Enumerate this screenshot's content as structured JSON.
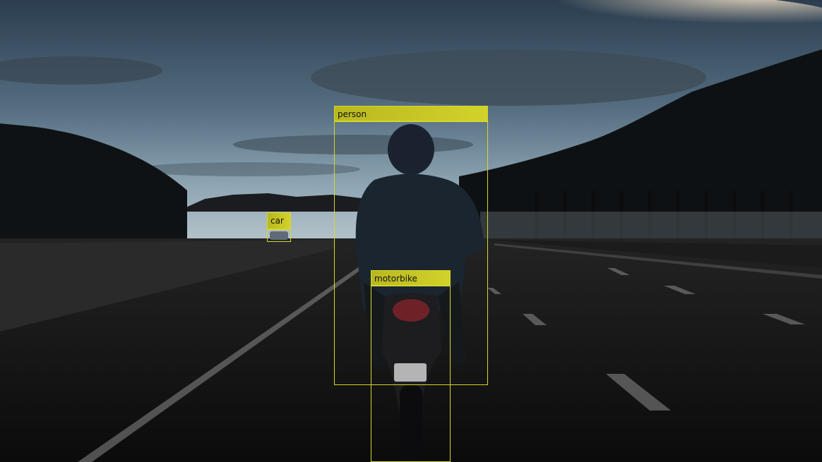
{
  "detections": {
    "person": {
      "label": "person"
    },
    "motorbike": {
      "label": "motorbike"
    },
    "car": {
      "label": "car"
    }
  },
  "colors": {
    "box": "#d6d62a",
    "sky_top": "#2d4356",
    "sky_horizon": "#9eb3c0",
    "road": "#141414"
  }
}
